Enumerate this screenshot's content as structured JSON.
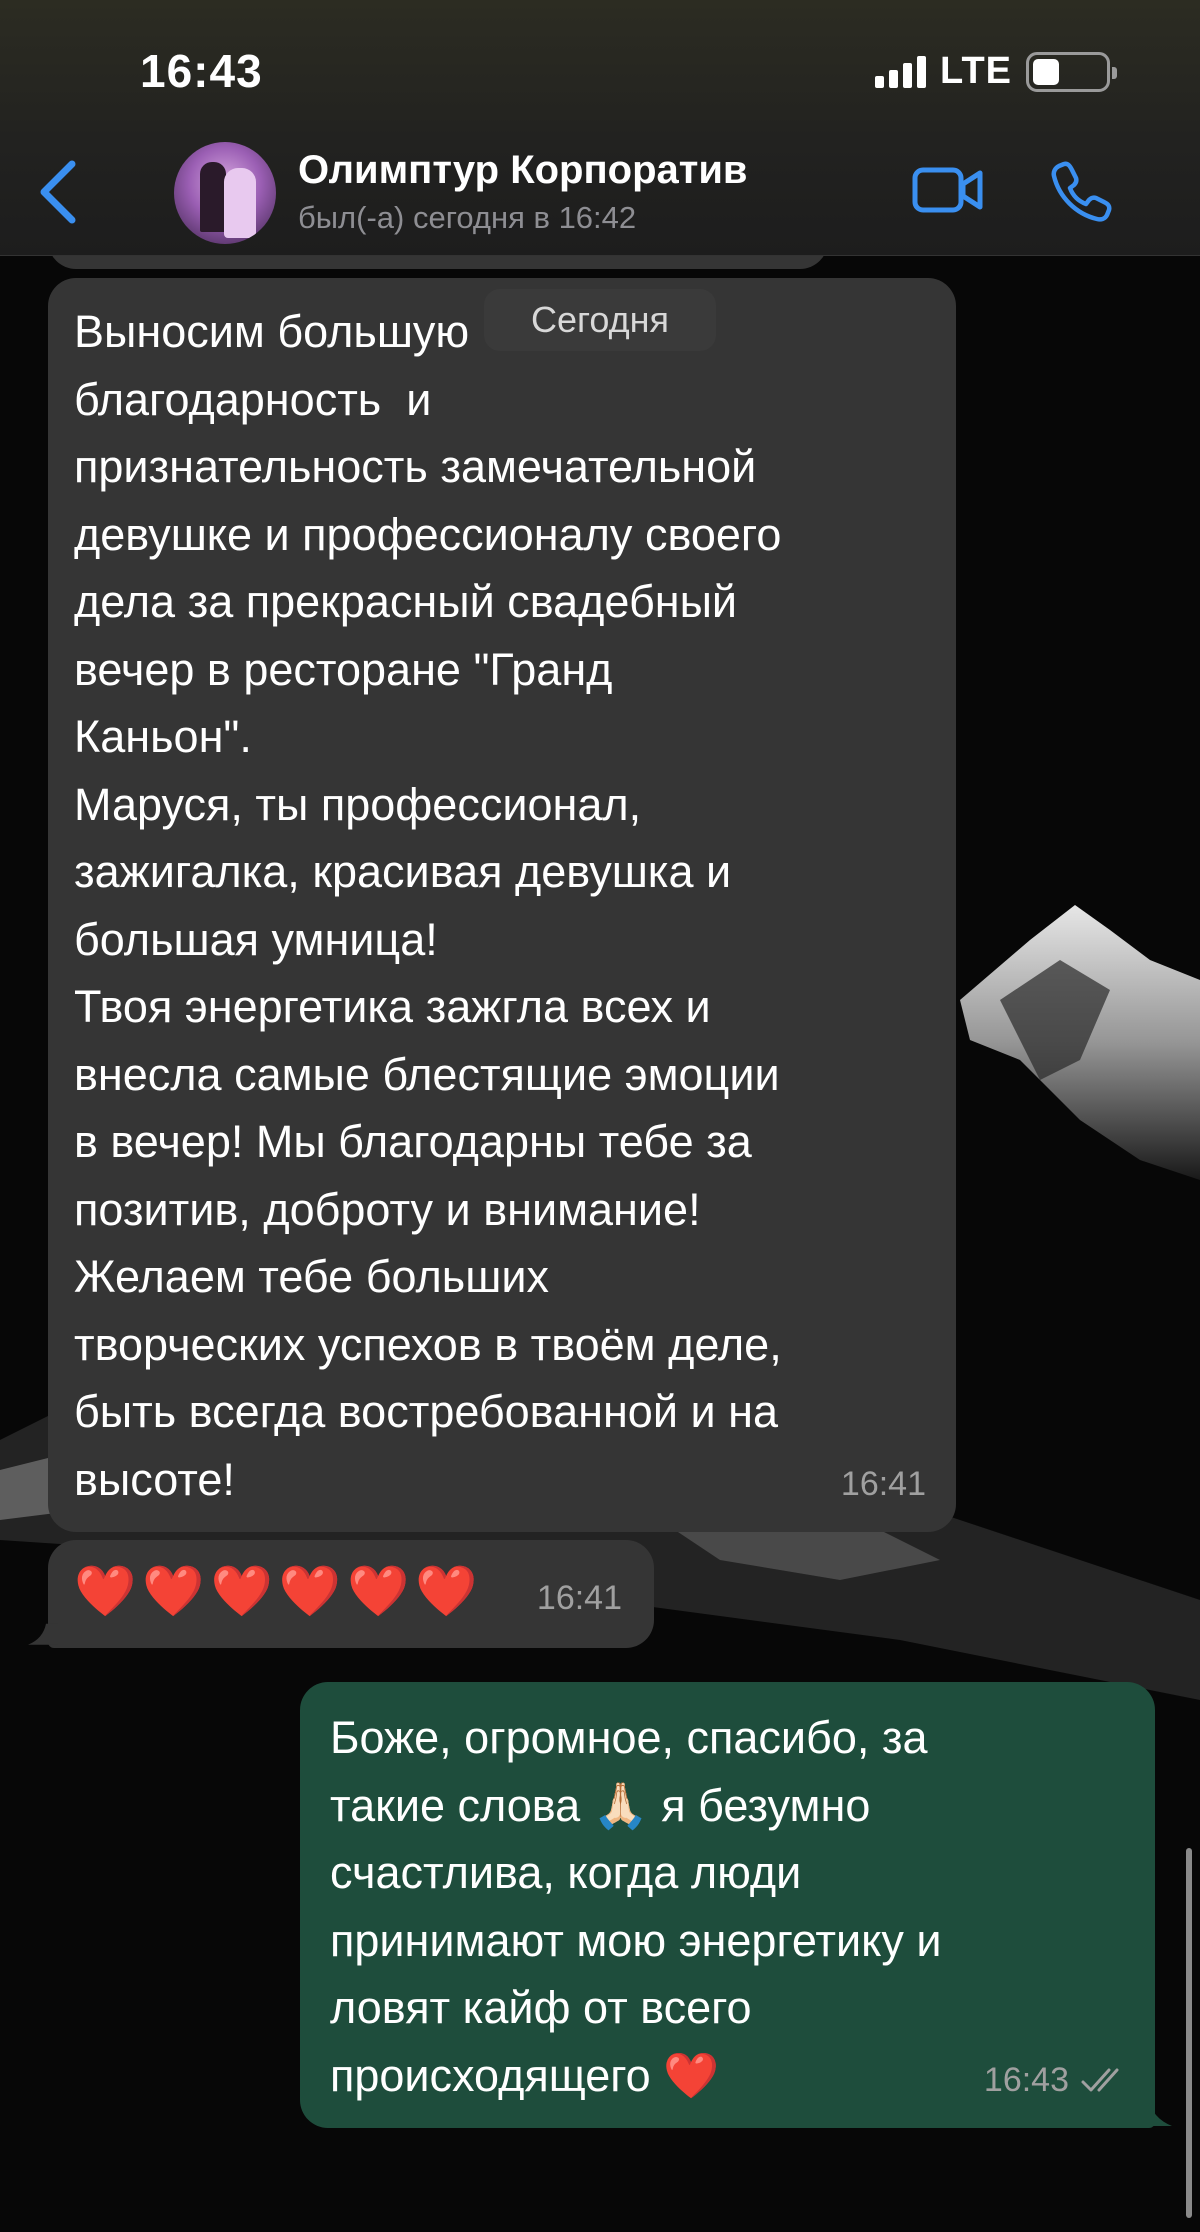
{
  "status_bar": {
    "time": "16:43",
    "network": "LTE"
  },
  "header": {
    "contact_name": "Олимптур Корпоратив",
    "contact_status": "был(-а) сегодня в 16:42"
  },
  "date_separator": "Сегодня",
  "messages": [
    {
      "direction": "incoming",
      "text": "Выносим большую\nблагодарность  и\nпризнательность замечательной\nдевушке и профессионалу своего\nдела за прекрасный свадебный\nвечер в ресторане \"Гранд\nКаньон\".\nМаруся, ты профессионал,\nзажигалка, красивая девушка и\nбольшая умница!\nТвоя энергетика зажгла всех и\nвнесла самые блестящие эмоции\nв вечер! Мы благодарны тебе за\nпозитив, доброту и внимание!\nЖелаем тебе больших\nтворческих успехов в твоём деле,\nбыть всегда востребованной и на\nвысоте!",
      "time": "16:41"
    },
    {
      "direction": "incoming",
      "text": "❤️❤️❤️❤️❤️❤️",
      "time": "16:41"
    },
    {
      "direction": "outgoing",
      "text": "Боже, огромное, спасибо, за\nтакие слова 🙏🏻 я безумно\nсчастлива, когда люди\nпринимают мою энергетику и\nловят кайф от всего\nпроисходящего ❤️",
      "time": "16:43",
      "read": true
    }
  ],
  "colors": {
    "accent": "#3a8ff0",
    "incoming_bubble": "#353535",
    "outgoing_bubble": "#1e4d3c"
  }
}
